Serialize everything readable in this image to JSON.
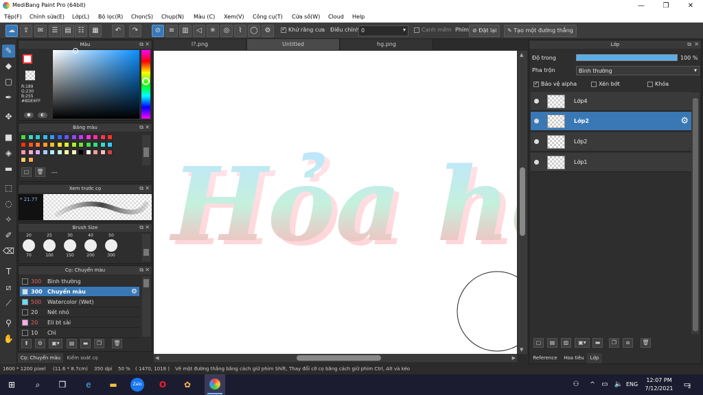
{
  "window": {
    "title": "MediBang Paint Pro (64bit)",
    "minimize": "—",
    "maximize": "❐",
    "close": "✕"
  },
  "menu": [
    "Tệp(F)",
    "Chỉnh sửa(E)",
    "Lớp(L)",
    "Bộ lọc(R)",
    "Chọn(S)",
    "Chụp(N)",
    "Màu (C)",
    "Xem(V)",
    "Công cụ(T)",
    "Cửa số(W)",
    "Cloud",
    "Help"
  ],
  "toolbar": {
    "antialias_label": "Khử răng cưa",
    "adjust_label": "Điều chỉnh",
    "adjust_value": "0",
    "edge_label": "Cạnh mềm",
    "brush_label": "Phím",
    "reset_label": "Đặt lại",
    "line_label": "Tạo một đường thẳng"
  },
  "color_panel": {
    "title": "Màu",
    "rgb_r": "R:189",
    "rgb_g": "G:230",
    "rgb_b": "B:255",
    "hex": "#BDE6FF"
  },
  "palette_panel": {
    "title": "Bảng màu",
    "footer_text": "---",
    "swatches": [
      "#44dd44",
      "#33ddbb",
      "#33cccc",
      "#33bbee",
      "#3399ff",
      "#3366ff",
      "#6655ff",
      "#9944ff",
      "#cc33ff",
      "#ff33dd",
      "#ff3399",
      "#ff3355",
      "#ff3322",
      "#ff3300",
      "#ff5522",
      "#ff7733",
      "#ff9933",
      "#ffbb33",
      "#ffdd33",
      "#ddee33",
      "#aaee33",
      "#77dd33",
      "#44dd55",
      "#33dd88",
      "#33ddcc",
      "#33ccff",
      "#ff99aa",
      "#ffaacc",
      "#ddaaff",
      "#aaccff",
      "#aaeeff",
      "#ccffdd",
      "#ffffaa",
      "#ffeebb",
      "#000000",
      "#ffffff",
      "#ff9999",
      "#ffbbbb",
      "#cc4444",
      "#ffcc66",
      "#ffaa55"
    ]
  },
  "preview_panel": {
    "title": "Xem trước cọ",
    "size_label": "* 21.77"
  },
  "brush_size_panel": {
    "title": "Brush Size",
    "sizes": [
      "20",
      "25",
      "30",
      "40",
      "50"
    ],
    "sizes2": [
      "70",
      "100",
      "150",
      "200",
      "300"
    ]
  },
  "brush_panel": {
    "title": "Cọ: Chuyển màu",
    "items": [
      {
        "size": "300",
        "name": "Bình thường",
        "color": "#2a2a2a"
      },
      {
        "size": "300",
        "name": "Chuyển màu",
        "color": "#bde6ff"
      },
      {
        "size": "500",
        "name": "Watercolor (Wet)",
        "color": "#66ddff"
      },
      {
        "size": "20",
        "name": "Nét nhỏ",
        "color": "#2a2a2a"
      },
      {
        "size": "20",
        "name": "Eli bt sài",
        "color": "#ffaaee"
      },
      {
        "size": "10",
        "name": "Chì",
        "color": "#2a2a2a"
      }
    ]
  },
  "bottom_tabs": {
    "tab1": "Cọ: Chuyển màu",
    "tab2": "Kiểm soát cọ"
  },
  "doc_tabs": [
    "l?.png",
    "Untitled",
    "hg.png"
  ],
  "canvas": {
    "artwork_text": "Hỏa học",
    "gradient_top": "#bde6ff",
    "gradient_mid": "#c5f0dc",
    "gradient_bottom": "#ffb3b8"
  },
  "layer_panel": {
    "title": "Lớp",
    "opacity_label": "Độ trong",
    "opacity_value": "100 %",
    "blend_label": "Pha trộn",
    "blend_value": "Bình thường",
    "alpha_label": "Bảo vệ alpha",
    "clip_label": "Xén bớt",
    "lock_label": "Khóa",
    "layers": [
      "Lớp4",
      "Lớp2",
      "Lớp2",
      "Lớp1"
    ],
    "tabs": [
      "Reference",
      "Hoa tiêu",
      "Lớp"
    ]
  },
  "status": {
    "dims": "1600 * 1200 pixel",
    "size_cm": "(11.6 * 8.7cm)",
    "dpi": "350 dpi",
    "zoom": "50 %",
    "coords": "( 1470, 1018 )",
    "hint": "Vẽ một đường thẳng bằng cách giữ phím Shift, Thay đổi cỡ cọ bằng cách giữ phím Ctrl, Alt và kéo"
  },
  "taskbar": {
    "time": "12:07 PM",
    "date": "7/12/2021",
    "lang": "ENG",
    "notif": "2"
  }
}
